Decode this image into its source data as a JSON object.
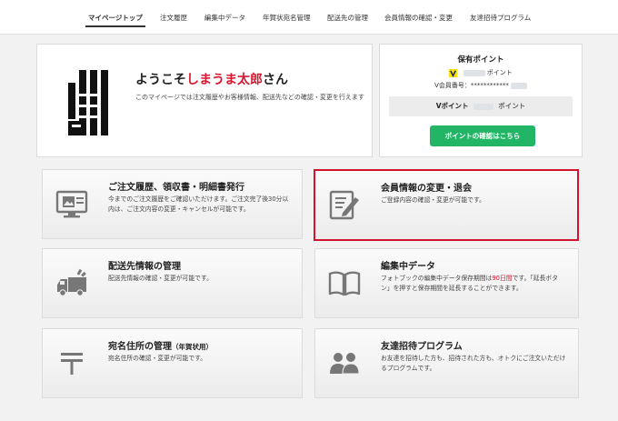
{
  "nav": {
    "items": [
      "マイページトップ",
      "注文履歴",
      "編集中データ",
      "年賀状宛名管理",
      "配送先の管理",
      "会員情報の確認・変更",
      "友達招待プログラム"
    ]
  },
  "welcome": {
    "greeting_prefix": "ようこそ",
    "user_name": "しまうま太郎",
    "greeting_suffix": "さん",
    "description": "このマイページでは注文履歴やお客様情報、配送先などの確認・変更を行えます"
  },
  "points": {
    "title": "保有ポイント",
    "points_suffix": "ポイント",
    "member_label": "V会員番号：",
    "member_number_masked": "************",
    "vpoint_label": "Vポイント",
    "vpoint_suffix": "ポイント",
    "button_label": "ポイントの確認はこちら"
  },
  "tiles": {
    "orders": {
      "title": "ご注文履歴、領収書・明細書発行",
      "desc": "今までのご注文履歴をご確認いただけます。ご注文完了後30分以内は、ご注文内容の変更・キャンセルが可能です。"
    },
    "member": {
      "title": "会員情報の変更・退会",
      "desc": "ご登録内容の確認・変更が可能です。"
    },
    "shipping": {
      "title": "配送先情報の管理",
      "desc": "配送先情報の確認・変更が可能です。"
    },
    "editing": {
      "title": "編集中データ",
      "desc_before": "フォトブックの編集中データ保存期間は",
      "desc_highlight": "90日間",
      "desc_after": "です。「延長ボタン」を押すと保存期間を延長することができます。"
    },
    "address": {
      "title": "宛名住所の管理",
      "title_sub": "（年賀状用）",
      "desc": "宛名住所の確認・変更が可能です。"
    },
    "invite": {
      "title": "友達招待プログラム",
      "desc": "お友達を招待した方も、招待された方も、オトクにご注文いただけるプログラムです。"
    }
  },
  "colors": {
    "accent_red": "#d8182f",
    "button_green": "#23b566",
    "highlight_border": "#d1132c"
  },
  "icons": [
    "monitor-icon",
    "pencil-note-icon",
    "truck-icon",
    "open-book-icon",
    "postal-mark-icon",
    "people-icon",
    "v-point-icon"
  ]
}
